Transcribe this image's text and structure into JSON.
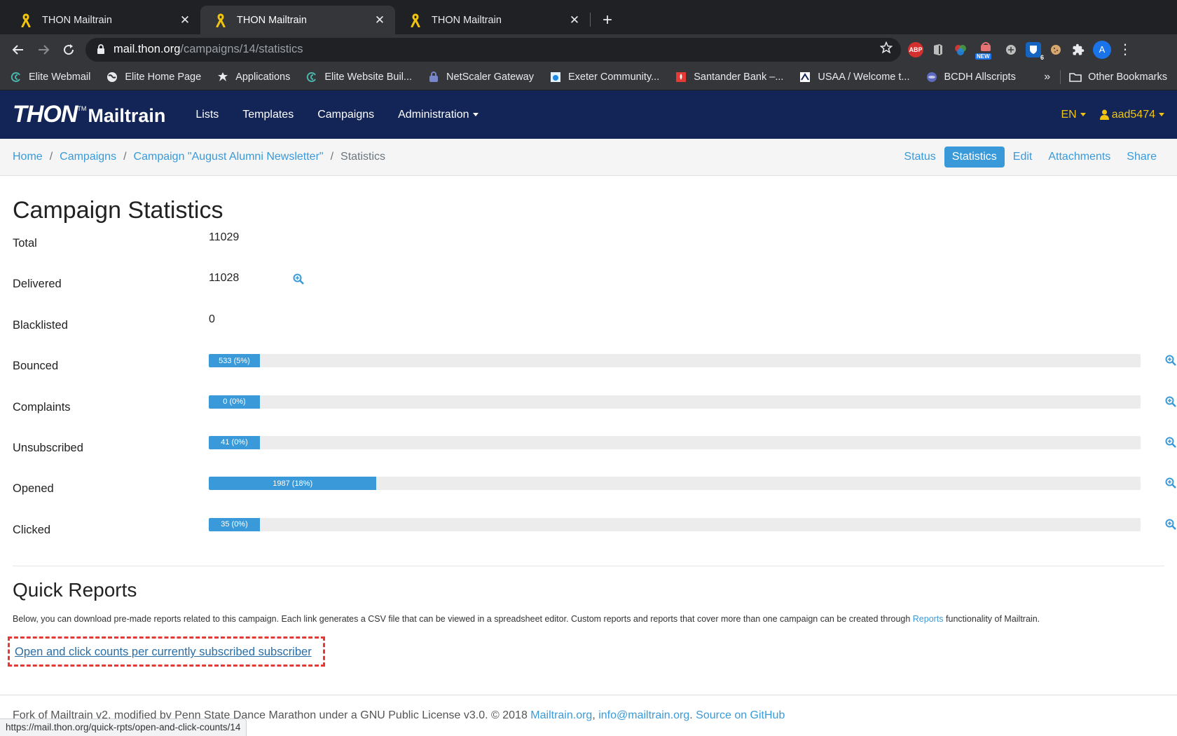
{
  "browser": {
    "tabs": [
      {
        "title": "THON Mailtrain",
        "active": false
      },
      {
        "title": "THON Mailtrain",
        "active": true
      },
      {
        "title": "THON Mailtrain",
        "active": false
      }
    ],
    "url_host": "mail.thon.org",
    "url_path": "/campaigns/14/statistics",
    "bookmarks": [
      {
        "label": "Elite Webmail",
        "icon": "elite-icon",
        "color": "#4db6ac"
      },
      {
        "label": "Elite Home Page",
        "icon": "globe-icon",
        "color": "#e8eaed"
      },
      {
        "label": "Applications",
        "icon": "apps-icon",
        "color": "#e8eaed"
      },
      {
        "label": "Elite Website Buil...",
        "icon": "elite-icon",
        "color": "#4db6ac"
      },
      {
        "label": "NetScaler Gateway",
        "icon": "netscaler-icon",
        "color": "#5c6bc0"
      },
      {
        "label": "Exeter Community...",
        "icon": "exeter-icon",
        "color": "#90caf9"
      },
      {
        "label": "Santander Bank –...",
        "icon": "santander-icon",
        "color": "#e53935"
      },
      {
        "label": "USAA / Welcome t...",
        "icon": "usaa-icon",
        "color": "#ffffff"
      },
      {
        "label": "BCDH Allscripts",
        "icon": "bcdh-icon",
        "color": "#5c6bc0"
      }
    ],
    "overflow_label": "»",
    "other_bookmarks": "Other Bookmarks",
    "profile_initial": "A",
    "ext_badge_new": "NEW",
    "ext_badge_count": "6",
    "abp_label": "ABP"
  },
  "app": {
    "brand_thon": "THON",
    "brand_tm": "TM",
    "brand_mailtrain": "Mailtrain",
    "nav": [
      "Lists",
      "Templates",
      "Campaigns",
      "Administration"
    ],
    "lang": "EN",
    "user": "aad5474"
  },
  "breadcrumb": [
    "Home",
    "Campaigns",
    "Campaign \"August Alumni Newsletter\"",
    "Statistics"
  ],
  "secondary_nav": [
    {
      "label": "Status",
      "active": false
    },
    {
      "label": "Statistics",
      "active": true
    },
    {
      "label": "Edit",
      "active": false
    },
    {
      "label": "Attachments",
      "active": false
    },
    {
      "label": "Share",
      "active": false
    }
  ],
  "page_title": "Campaign Statistics",
  "stats": {
    "total": {
      "label": "Total",
      "value": "11029"
    },
    "delivered": {
      "label": "Delivered",
      "value": "11028"
    },
    "blacklisted": {
      "label": "Blacklisted",
      "value": "0"
    },
    "bars": [
      {
        "label": "Bounced",
        "text": "533 (5%)",
        "fraction": 0.05
      },
      {
        "label": "Complaints",
        "text": "0 (0%)",
        "fraction": 0.0
      },
      {
        "label": "Unsubscribed",
        "text": "41 (0%)",
        "fraction": 0.0
      },
      {
        "label": "Opened",
        "text": "1987 (18%)",
        "fraction": 0.18
      },
      {
        "label": "Clicked",
        "text": "35 (0%)",
        "fraction": 0.0
      }
    ]
  },
  "quick_reports": {
    "title": "Quick Reports",
    "desc_before": "Below, you can download pre-made reports related to this campaign. Each link generates a CSV file that can be viewed in a spreadsheet editor. Custom reports and reports that cover more than one campaign can be created through ",
    "desc_link": "Reports",
    "desc_after": " functionality of Mailtrain.",
    "link_label": "Open and click counts per currently subscribed subscriber"
  },
  "footer": {
    "text": "Fork of Mailtrain v2, modified by Penn State Dance Marathon under a GNU Public License v3.0. © 2018 ",
    "link1": "Mailtrain.org",
    "sep1": ", ",
    "link2": "info@mailtrain.org",
    "sep2": ". ",
    "link3": "Source on GitHub"
  },
  "status_url": "https://mail.thon.org/quick-rpts/open-and-click-counts/14",
  "colors": {
    "navbar": "#132557",
    "accent": "#3a9ad9",
    "highlight": "#e53935"
  }
}
